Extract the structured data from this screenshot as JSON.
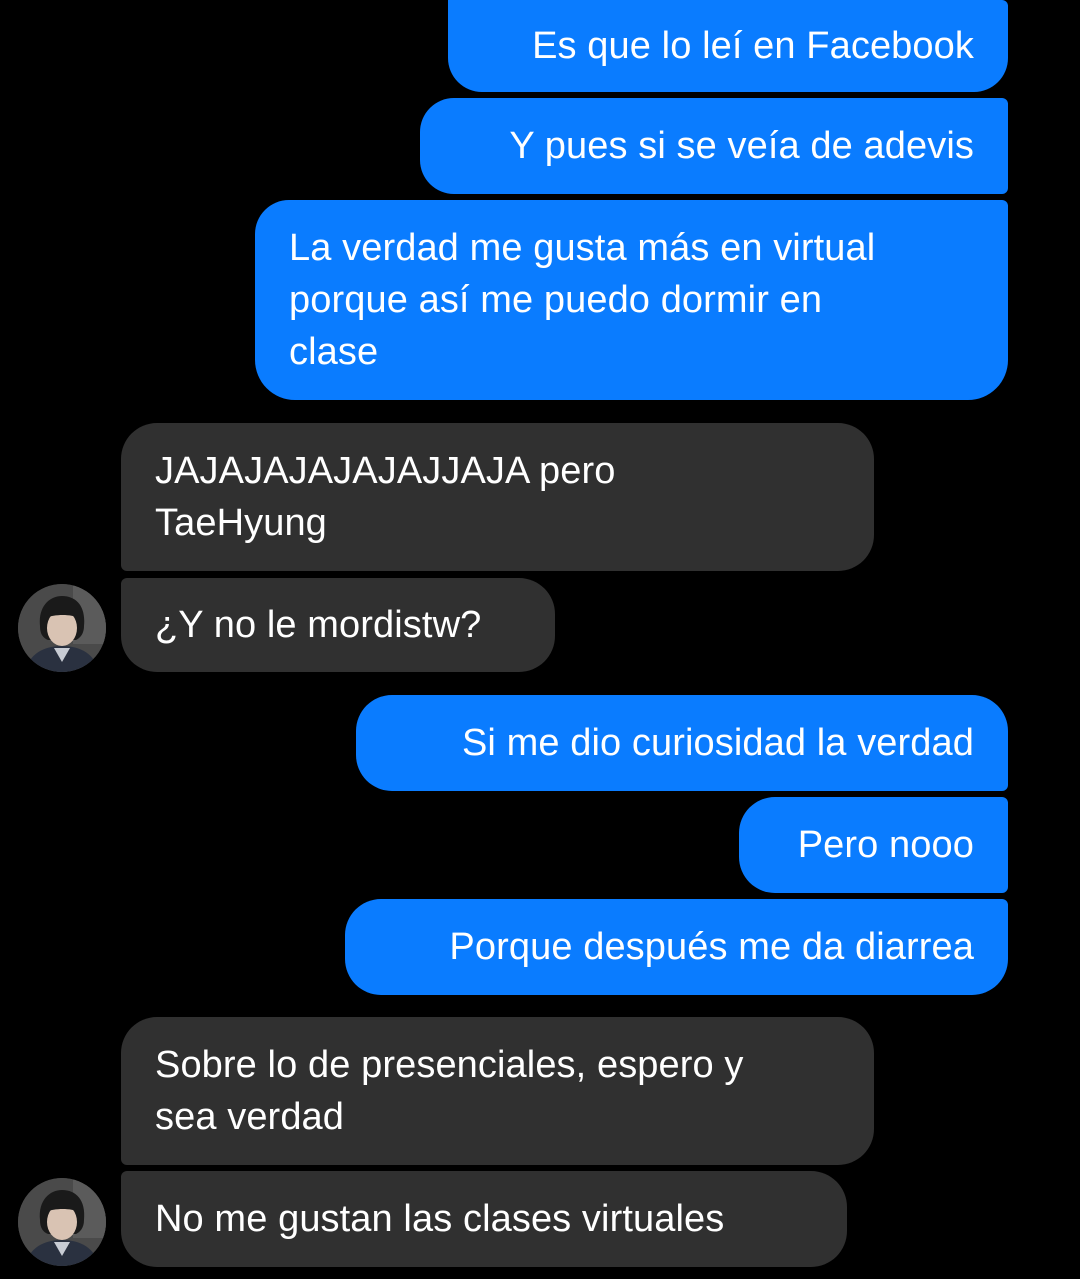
{
  "colors": {
    "background": "#000000",
    "outgoing_bubble": "#0A7CFF",
    "incoming_bubble": "#303030",
    "text": "#FFFFFF"
  },
  "messages": [
    {
      "direction": "out",
      "text": "Es que lo leí en Facebook"
    },
    {
      "direction": "out",
      "text": "Y pues si se veía de adevis"
    },
    {
      "direction": "out",
      "text": "La verdad me gusta más en virtual\nporque así me puedo dormir en\nclase"
    },
    {
      "direction": "in",
      "text": "JAJAJAJAJAJAJJAJA pero\nTaeHyung"
    },
    {
      "direction": "in",
      "text": "¿Y no le mordistw?",
      "avatar": "contact-avatar"
    },
    {
      "direction": "out",
      "text": "Si me dio curiosidad la verdad"
    },
    {
      "direction": "out",
      "text": "Pero nooo"
    },
    {
      "direction": "out",
      "text": "Porque después me da diarrea"
    },
    {
      "direction": "in",
      "text": "Sobre lo de presenciales, espero y\nsea verdad"
    },
    {
      "direction": "in",
      "text": "No me gustan las clases virtuales",
      "avatar": "contact-avatar"
    }
  ]
}
